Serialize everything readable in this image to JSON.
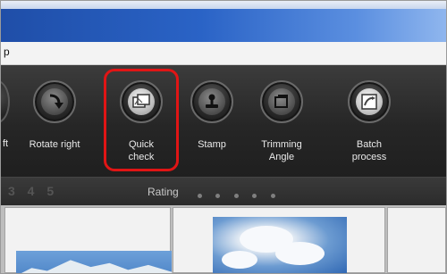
{
  "menubar": {
    "partial_item": "p"
  },
  "toolbar": {
    "partial_left_label": "ft",
    "items": [
      {
        "label": "Rotate right",
        "icon": "rotate-right-icon"
      },
      {
        "label": "Quick\ncheck",
        "icon": "quick-check-icon"
      },
      {
        "label": "Stamp",
        "icon": "stamp-icon"
      },
      {
        "label": "Trimming\nAngle",
        "icon": "trimming-angle-icon"
      },
      {
        "label": "Batch\nprocess",
        "icon": "batch-process-icon"
      }
    ],
    "highlight_color": "#e01515"
  },
  "rating_bar": {
    "digits": "3 4 5",
    "label": "Rating"
  }
}
